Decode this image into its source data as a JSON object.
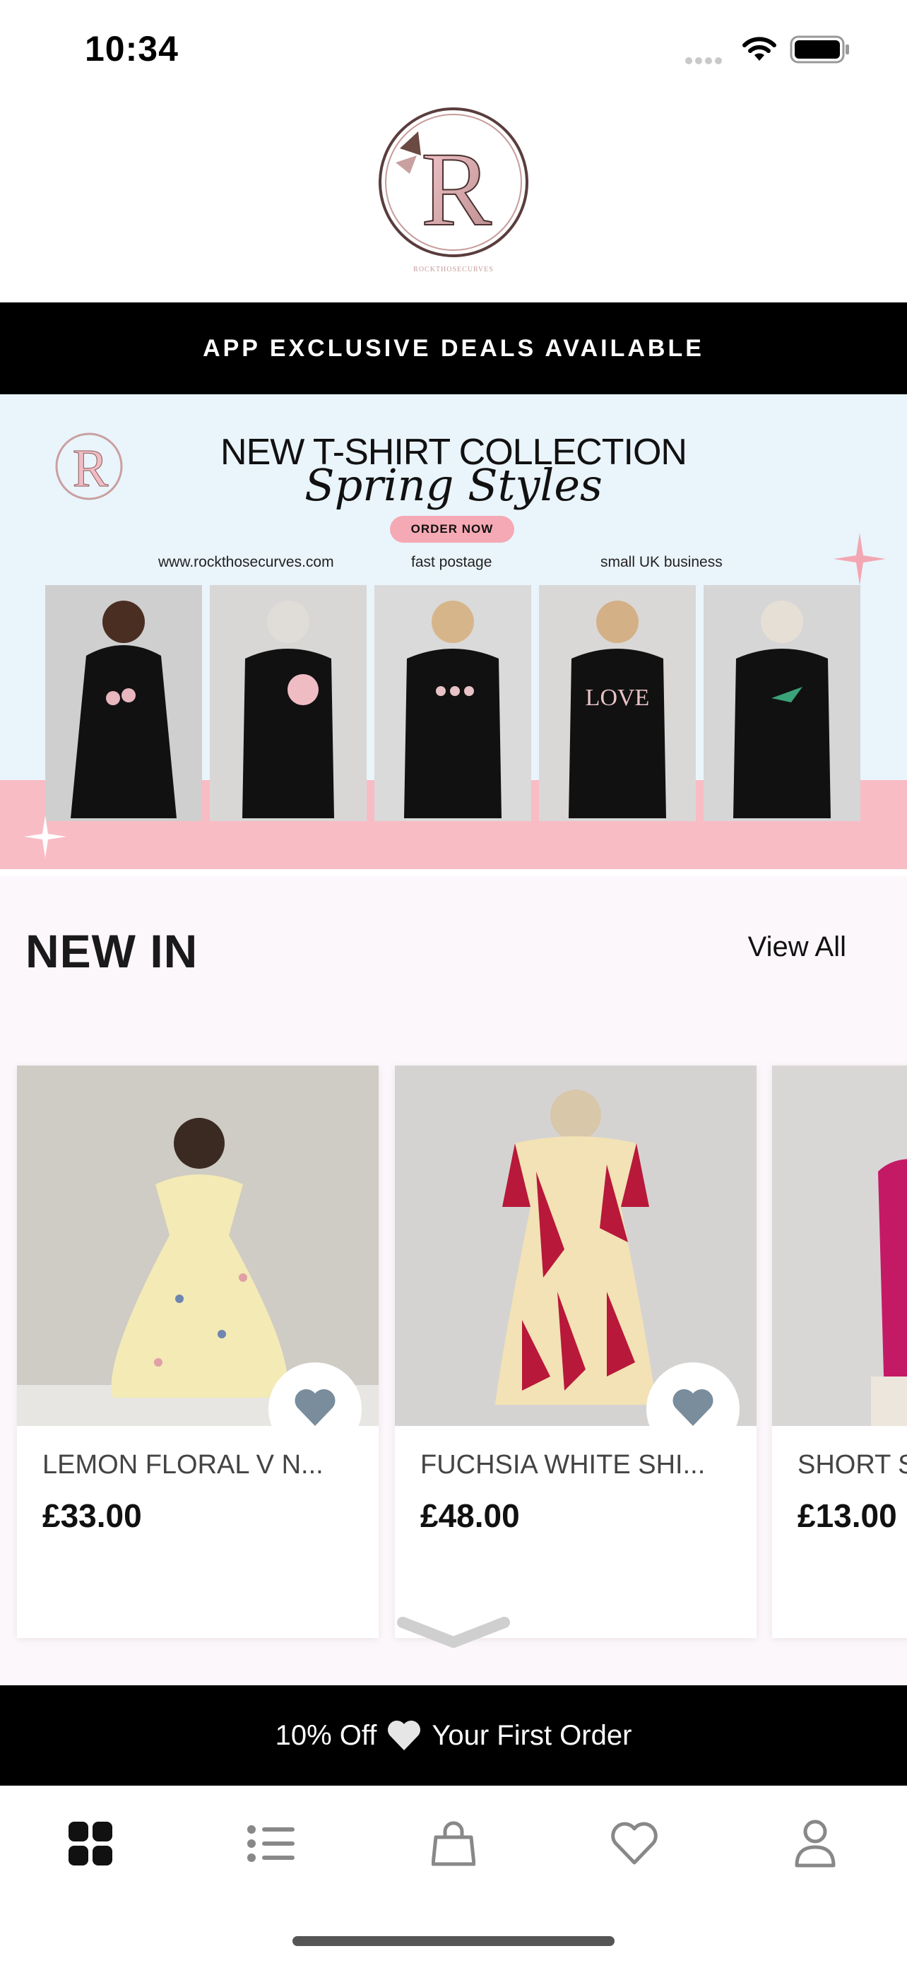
{
  "status_bar": {
    "time": "10:34"
  },
  "brand": {
    "logo_letter": "R",
    "logo_tagline": "ROCKTHOSECURVES"
  },
  "promo_bar": {
    "text": "APP EXCLUSIVE DEALS AVAILABLE"
  },
  "banner": {
    "title": "NEW T-SHIRT COLLECTION",
    "script": "Spring Styles",
    "cta": "ORDER NOW",
    "meta": [
      "www.rockthosecurves.com",
      "fast postage",
      "small UK business"
    ],
    "shirt_prints": [
      "flowers",
      "rose",
      "birds",
      "LOVE",
      "hummingbird"
    ]
  },
  "new_in": {
    "heading": "NEW IN",
    "view_all": "View All",
    "products": [
      {
        "name": "LEMON FLORAL V N...",
        "price": "£33.00"
      },
      {
        "name": "FUCHSIA WHITE SHI...",
        "price": "£48.00"
      },
      {
        "name": "SHORT S",
        "price": "£13.00"
      }
    ]
  },
  "offer_bar": {
    "text_before": "10% Off",
    "text_after": "Your First Order"
  },
  "tab_bar": {
    "tabs": [
      {
        "icon": "home-grid-icon",
        "active": true
      },
      {
        "icon": "list-icon",
        "active": false
      },
      {
        "icon": "shopping-bag-icon",
        "active": false
      },
      {
        "icon": "heart-icon",
        "active": false
      },
      {
        "icon": "person-icon",
        "active": false
      }
    ]
  },
  "colors": {
    "accent_pink": "#f8bcc4",
    "banner_bg": "#eaf4fb",
    "heart_fill": "#7a8d9c",
    "black": "#000000"
  }
}
